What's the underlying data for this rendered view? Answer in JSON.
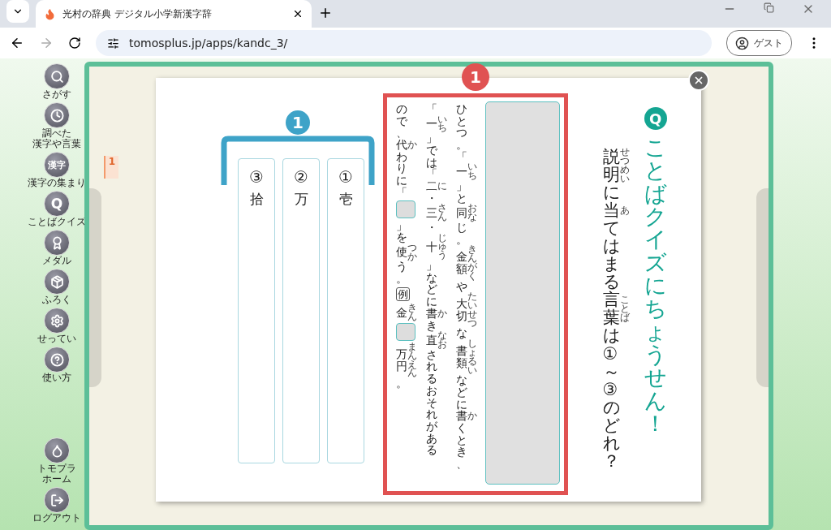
{
  "browser": {
    "tab_title": "光村の辞典 デジタル小学新漢字辞",
    "url": "tomosplus.jp/apps/kandc_3/",
    "profile": "ゲスト"
  },
  "sidebar": {
    "items": [
      {
        "kind": "search",
        "label": [
          "さがす"
        ]
      },
      {
        "kind": "history",
        "label": [
          "調べた",
          "漢字や言葉"
        ]
      },
      {
        "kind": "glyph",
        "icon_text": "漢字",
        "label": [
          "漢字の集まり"
        ]
      },
      {
        "kind": "glyph",
        "icon_text": "Q",
        "label": [
          "ことばクイズ"
        ]
      },
      {
        "kind": "medal",
        "label": [
          "メダル"
        ]
      },
      {
        "kind": "box",
        "label": [
          "ふろく"
        ]
      },
      {
        "kind": "settings",
        "label": [
          "せってい"
        ]
      },
      {
        "kind": "help",
        "label": [
          "使い方"
        ]
      }
    ],
    "bottom_items": [
      {
        "kind": "home",
        "label": [
          "トモプラ",
          "ホーム"
        ]
      },
      {
        "kind": "logout",
        "label": [
          "ログアウト"
        ]
      }
    ]
  },
  "book": {
    "page_tab": "1"
  },
  "quiz": {
    "q_icon": "Q",
    "title": "ことばクイズにちょうせん！",
    "question": [
      {
        "kind": "text",
        "text": "説明",
        "ruby": "せつめい"
      },
      {
        "kind": "text",
        "text": "に"
      },
      {
        "kind": "text",
        "text": "当",
        "ruby": "あ"
      },
      {
        "kind": "text",
        "text": "てはまる"
      },
      {
        "kind": "text",
        "text": "言葉",
        "ruby": "ことば"
      },
      {
        "kind": "text",
        "text": "は①～③のどれ？"
      }
    ],
    "answer_box": {
      "badge": "1",
      "columns": [
        [
          {
            "kind": "text",
            "text": "ので、"
          },
          {
            "kind": "text",
            "text": "代",
            "ruby": "か"
          },
          {
            "kind": "text",
            "text": "わりに「"
          },
          {
            "kind": "blank"
          },
          {
            "kind": "text",
            "text": "」を"
          },
          {
            "kind": "text",
            "text": "使",
            "ruby": "つか"
          },
          {
            "kind": "text",
            "text": "う。"
          },
          {
            "kind": "example",
            "text": "例"
          },
          {
            "kind": "text",
            "text": "金",
            "ruby": "きん"
          },
          {
            "kind": "blank"
          },
          {
            "kind": "text",
            "text": "万円",
            "ruby": "まんえん"
          },
          {
            "kind": "text",
            "text": "。"
          }
        ],
        [
          {
            "kind": "text",
            "text": "「"
          },
          {
            "kind": "text",
            "text": "一",
            "ruby": "いち"
          },
          {
            "kind": "text",
            "text": "」では「"
          },
          {
            "kind": "text",
            "text": "二",
            "ruby": "に"
          },
          {
            "kind": "text",
            "text": "・"
          },
          {
            "kind": "text",
            "text": "三",
            "ruby": "さん"
          },
          {
            "kind": "text",
            "text": "・"
          },
          {
            "kind": "text",
            "text": "十",
            "ruby": "じゅう"
          },
          {
            "kind": "text",
            "text": "」などに"
          },
          {
            "kind": "text",
            "text": "書",
            "ruby": "か"
          },
          {
            "kind": "text",
            "text": "き"
          },
          {
            "kind": "text",
            "text": "直",
            "ruby": "なお"
          },
          {
            "kind": "text",
            "text": "されるおそれがある"
          }
        ],
        [
          {
            "kind": "text",
            "text": "ひとつ。「"
          },
          {
            "kind": "text",
            "text": "一",
            "ruby": "いち"
          },
          {
            "kind": "text",
            "text": "」と"
          },
          {
            "kind": "text",
            "text": "同",
            "ruby": "おな"
          },
          {
            "kind": "text",
            "text": "じ。"
          },
          {
            "kind": "text",
            "text": "金額",
            "ruby": "きんがく"
          },
          {
            "kind": "text",
            "text": "や"
          },
          {
            "kind": "text",
            "text": "大切",
            "ruby": "たいせつ"
          },
          {
            "kind": "text",
            "text": "な"
          },
          {
            "kind": "text",
            "text": "書類",
            "ruby": "しょるい"
          },
          {
            "kind": "text",
            "text": "などに"
          },
          {
            "kind": "text",
            "text": "書",
            "ruby": "か"
          },
          {
            "kind": "text",
            "text": "くとき、"
          }
        ]
      ]
    },
    "choices": {
      "badge": "1",
      "items": [
        {
          "number": "③",
          "kanji": "拾"
        },
        {
          "number": "②",
          "kanji": "万"
        },
        {
          "number": "①",
          "kanji": "壱"
        }
      ]
    }
  }
}
